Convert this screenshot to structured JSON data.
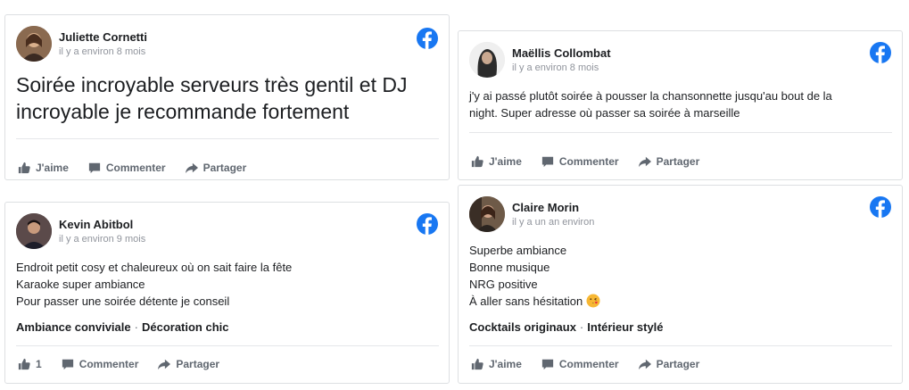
{
  "colors": {
    "facebook_blue": "#1877f2",
    "text": "#1c1e21",
    "muted": "#90949c",
    "action": "#606770"
  },
  "reviews": [
    {
      "name": "Juliette Cornetti",
      "time": "il y a environ 8 mois",
      "text_lines": [
        "Soirée incroyable serveurs très gentil et DJ",
        "incroyable je recommande fortement"
      ],
      "like_label": "J'aime",
      "comment_label": "Commenter",
      "share_label": "Partager"
    },
    {
      "name": "Maëllis Collombat",
      "time": "il y a environ 8 mois",
      "text_lines": [
        "j'y ai passé plutôt soirée à pousser la chansonnette jusqu'au bout de la",
        "night. Super adresse où passer sa soirée à marseille"
      ],
      "like_label": "J'aime",
      "comment_label": "Commenter",
      "share_label": "Partager"
    },
    {
      "name": "Kevin Abitbol",
      "time": "il y a environ 9 mois",
      "text_lines": [
        "Endroit petit cosy et chaleureux où on sait faire la fête",
        "Karaoke super ambiance",
        "Pour passer une soirée détente je conseil"
      ],
      "tags": [
        "Ambiance conviviale",
        "Décoration chic"
      ],
      "like_label": "1",
      "comment_label": "Commenter",
      "share_label": "Partager"
    },
    {
      "name": "Claire Morin",
      "time": "il y a un an environ",
      "text_lines": [
        "Superbe ambiance",
        "Bonne musique",
        "NRG positive",
        "À aller sans hésitation"
      ],
      "tags": [
        "Cocktails originaux",
        "Intérieur stylé"
      ],
      "like_label": "J'aime",
      "comment_label": "Commenter",
      "share_label": "Partager"
    }
  ],
  "tag_separator": "·"
}
